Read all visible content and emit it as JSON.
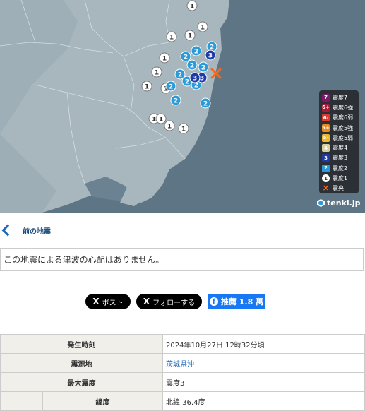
{
  "map": {
    "epicenter_label": "×",
    "intensity_markers": [
      "1",
      "1",
      "1",
      "1",
      "1",
      "1",
      "1",
      "1",
      "1",
      "1",
      "1",
      "1",
      "2",
      "2",
      "2",
      "2",
      "2",
      "2",
      "2",
      "2",
      "2",
      "2",
      "2",
      "3",
      "3",
      "3"
    ],
    "legend": [
      {
        "swatch": "7",
        "label": "震度7",
        "color": "#7b1a69"
      },
      {
        "swatch": "6+",
        "label": "震度6強",
        "color": "#a51c34"
      },
      {
        "swatch": "6-",
        "label": "震度6弱",
        "color": "#d93a31"
      },
      {
        "swatch": "5+",
        "label": "震度5強",
        "color": "#e98b24"
      },
      {
        "swatch": "5-",
        "label": "震度5弱",
        "color": "#eab930"
      },
      {
        "swatch": "4",
        "label": "震度4",
        "color": "#d8cf9c"
      },
      {
        "swatch": "3",
        "label": "震度3",
        "color": "#1d3aa7"
      },
      {
        "swatch": "2",
        "label": "震度2",
        "color": "#2a9bd8"
      },
      {
        "swatch": "1",
        "label": "震度1",
        "color": "#ffffff"
      }
    ],
    "legend_epicenter": "震央",
    "logo": "tenki.jp",
    "colors": {
      "land": "#a9b8bf",
      "sea": "#5e7585",
      "epicenter": "#f36a1f"
    }
  },
  "nav": {
    "back_label": "前の地震"
  },
  "notice": "この地震による津波の心配はありません。",
  "share": {
    "post_label": "ポスト",
    "follow_label": "フォローする",
    "fb_label": "推薦 1.8 萬",
    "x_icon": "X"
  },
  "table": {
    "rows": [
      {
        "label": "発生時刻",
        "value": "2024年10月27日 12時32分頃"
      },
      {
        "label": "震源地",
        "value": "茨城県沖"
      },
      {
        "label": "最大震度",
        "value": "震度3"
      },
      {
        "label": "緯度",
        "value": "北緯 36.4度"
      }
    ]
  }
}
